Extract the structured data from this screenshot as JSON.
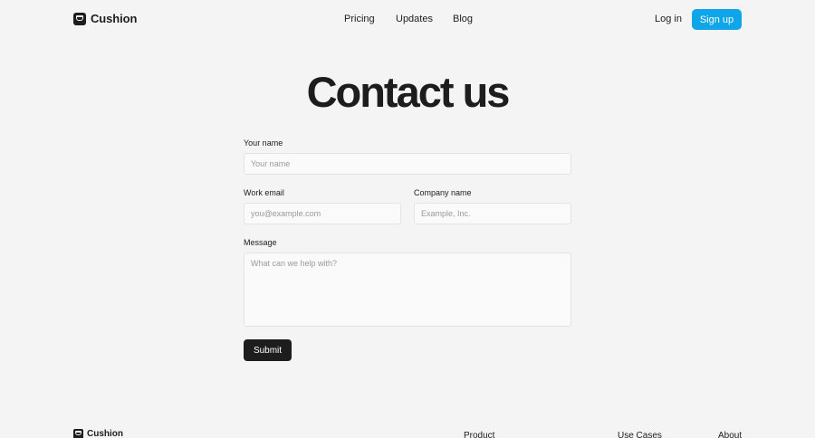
{
  "header": {
    "brand": "Cushion",
    "nav": [
      {
        "label": "Pricing"
      },
      {
        "label": "Updates"
      },
      {
        "label": "Blog"
      }
    ],
    "login_label": "Log in",
    "signup_label": "Sign up",
    "accent_color": "#0ea5e9"
  },
  "main": {
    "title": "Contact us",
    "form": {
      "name_label": "Your name",
      "name_placeholder": "Your name",
      "email_label": "Work email",
      "email_placeholder": "you@example.com",
      "company_label": "Company name",
      "company_placeholder": "Example, Inc.",
      "message_label": "Message",
      "message_placeholder": "What can we help with?",
      "submit_label": "Submit"
    }
  },
  "footer": {
    "brand": "Cushion",
    "columns": [
      {
        "heading": "Product"
      },
      {
        "heading": "Use Cases"
      },
      {
        "heading": "About"
      }
    ]
  }
}
